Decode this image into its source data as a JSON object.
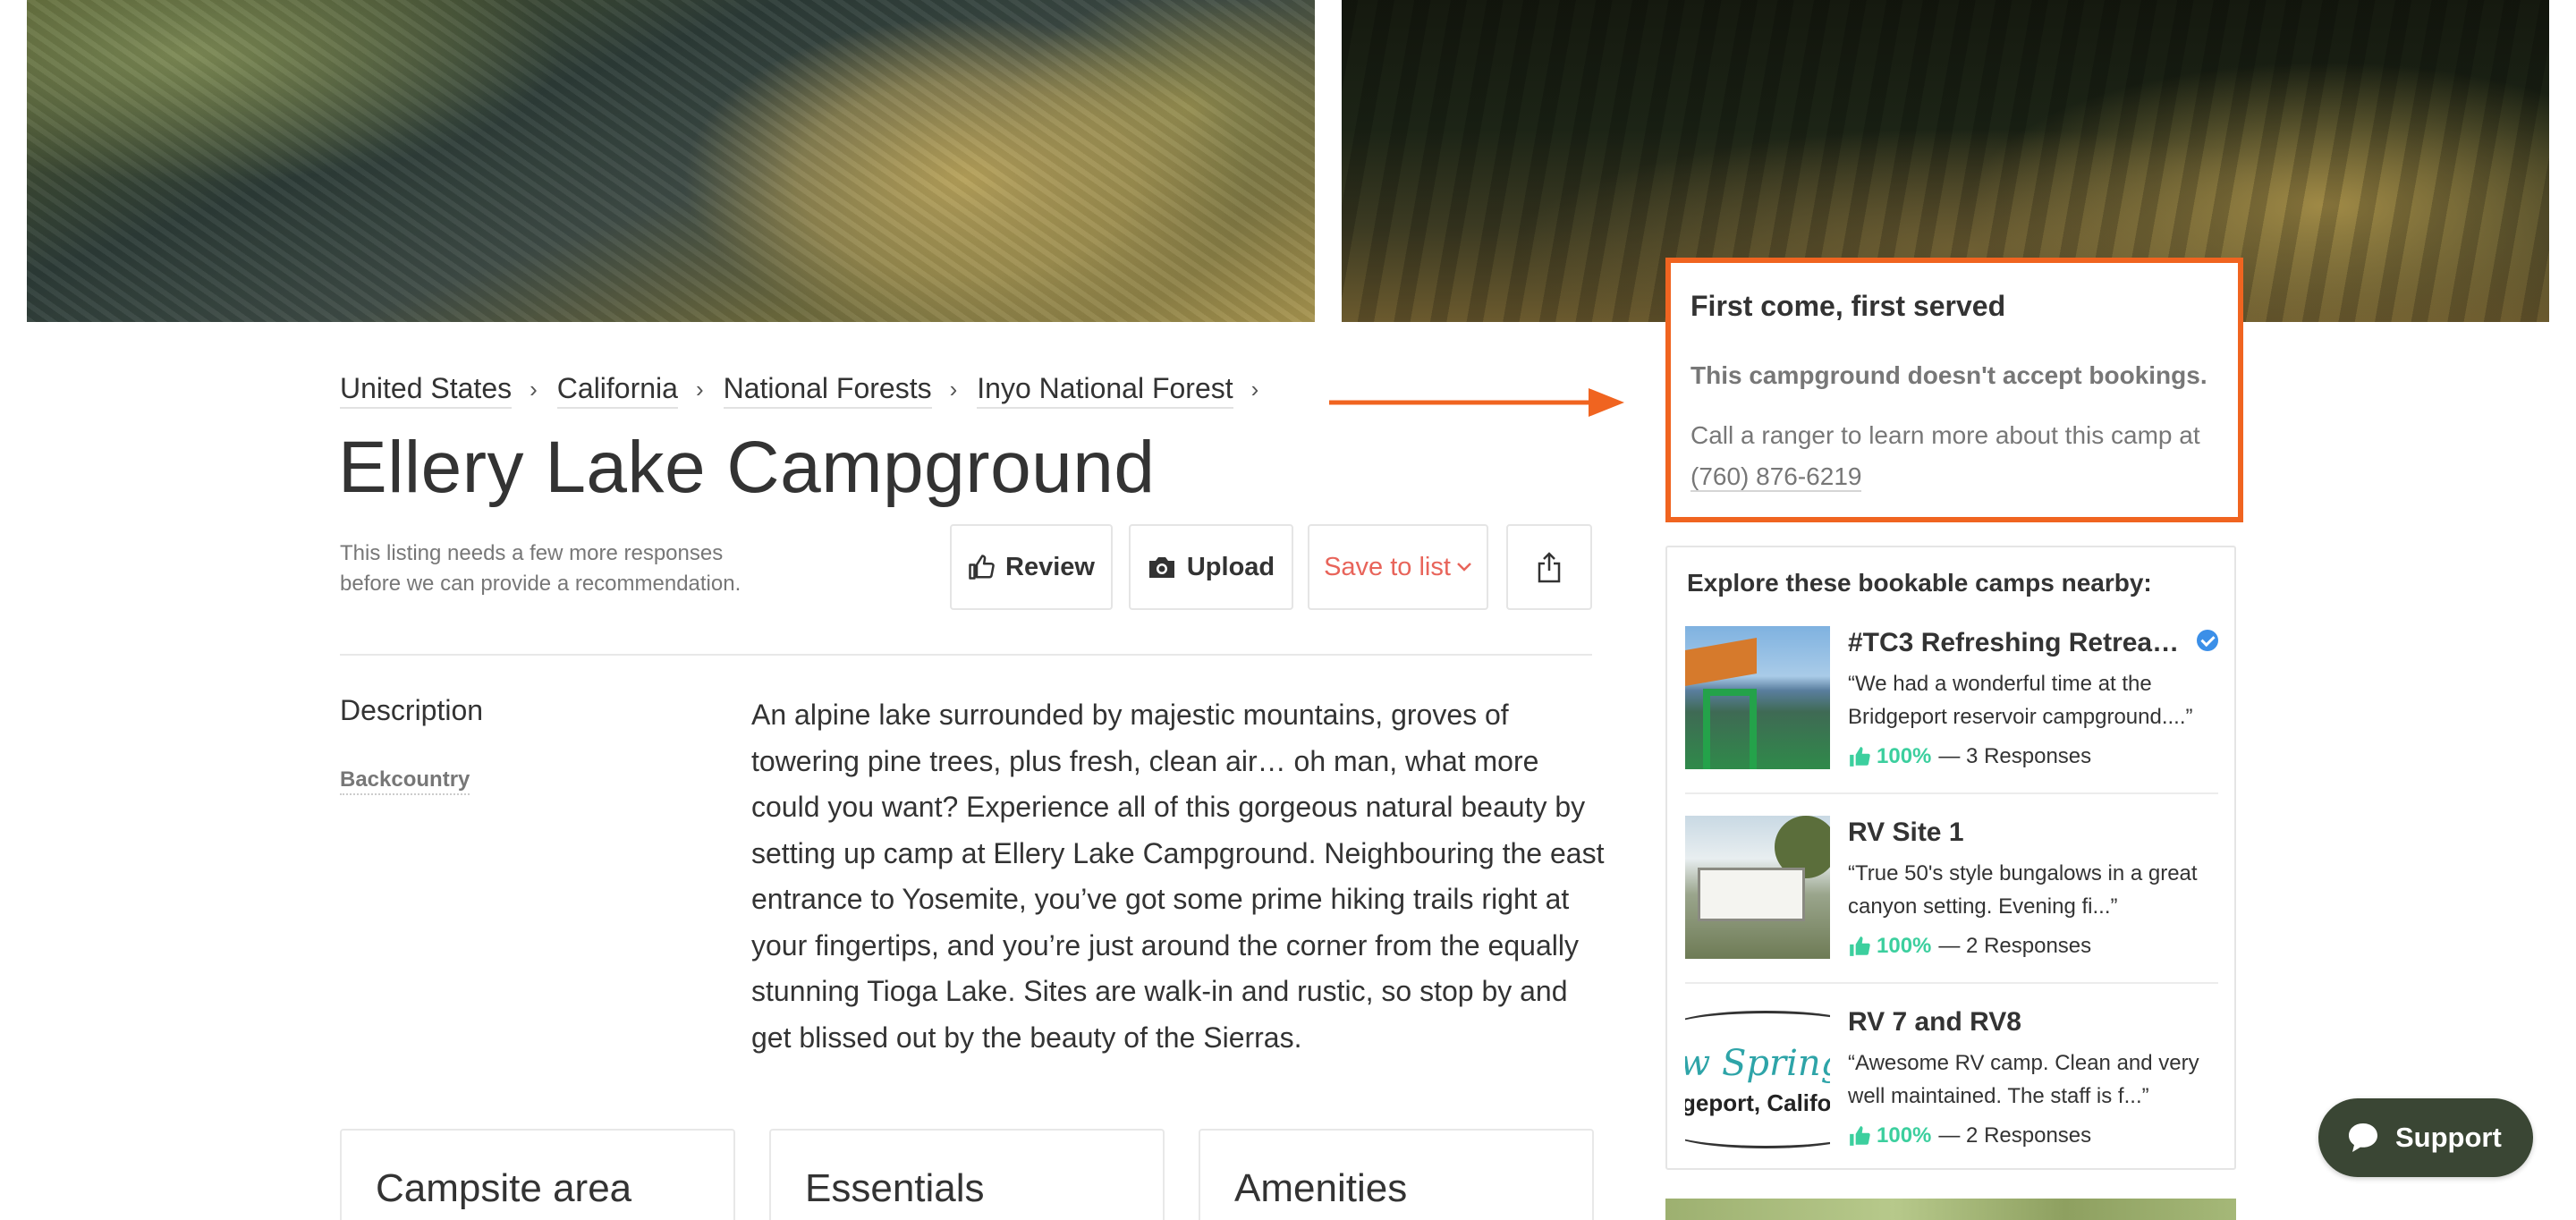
{
  "breadcrumb": [
    {
      "label": "United States"
    },
    {
      "label": "California"
    },
    {
      "label": "National Forests"
    },
    {
      "label": "Inyo National Forest"
    }
  ],
  "page_title": "Ellery Lake Campground",
  "listing_note": "This listing needs a few more responses before we can provide a recommendation.",
  "actions": {
    "review_label": "Review",
    "upload_label": "Upload",
    "save_label": "Save to list"
  },
  "description": {
    "label": "Description",
    "tag": "Backcountry",
    "text": "An alpine lake surrounded by majestic mountains, groves of towering pine trees, plus fresh, clean air… oh man, what more could you want? Experience all of this gorgeous natural beauty by setting up camp at Ellery Lake Campground. Neighbouring the east entrance to Yosemite, you’ve got some prime hiking trails right at your fingertips, and you’re just around the corner from the equally stunning Tioga Lake. Sites are walk-in and rustic, so stop by and get blissed out by the beauty of the Sierras."
  },
  "cards": [
    {
      "title": "Campsite area"
    },
    {
      "title": "Essentials"
    },
    {
      "title": "Amenities"
    }
  ],
  "booking_box": {
    "title": "First come, first served",
    "subtitle": "This campground doesn't accept bookings.",
    "text": "Call a ranger to learn more about this camp at",
    "phone": "(760) 876-6219"
  },
  "nearby": {
    "heading": "Explore these bookable camps nearby:",
    "camps": [
      {
        "name": "#TC3 Refreshing Retreat T...",
        "quote": "“We had a wonderful time at the Bridgeport reservoir campground....”",
        "percent": "100%",
        "responses": "— 3 Responses"
      },
      {
        "name": "RV Site 1",
        "quote": "“True 50's style bungalows in a great canyon setting. Evening fi...”",
        "percent": "100%",
        "responses": "— 2 Responses"
      },
      {
        "name": "RV 7 and RV8",
        "quote": "“Awesome RV camp. Clean and very well maintained. The staff is f...”",
        "percent": "100%",
        "responses": "— 2 Responses",
        "thumb_text_1": "w Springs",
        "thumb_text_2": "geport, Califo"
      }
    ]
  },
  "support_label": "Support",
  "colors": {
    "accent_orange": "#f06420",
    "save_red": "#e8645a",
    "positive_green": "#3ccf9e",
    "verified_blue": "#3b8fe8",
    "support_bg": "#3a4634"
  },
  "icons": {
    "review": "thumbs-up-icon",
    "upload": "camera-icon",
    "share": "share-icon",
    "save_dropdown": "chevron-down-icon",
    "breadcrumb_separator": "chevron-right-icon",
    "support": "chat-bubble-icon",
    "verified": "verified-check-icon"
  }
}
